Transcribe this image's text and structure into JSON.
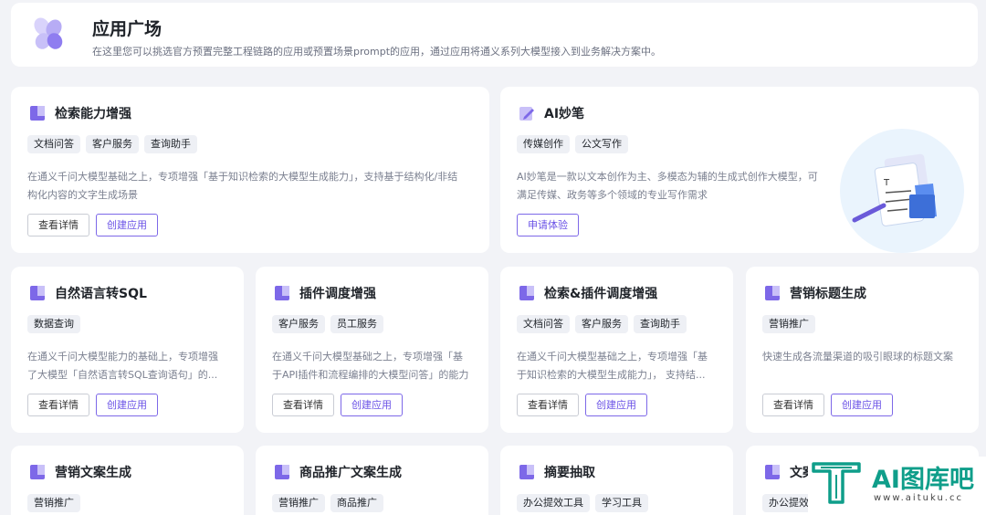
{
  "header": {
    "title": "应用广场",
    "desc": "在这里您可以挑选官方预置完整工程链路的应用或预置场景prompt的应用，通过应用将通义系列大模型接入到业务解决方案中。"
  },
  "cards": [
    {
      "title": "检索能力增强",
      "icon": "bookmark-icon",
      "tags": [
        "文档问答",
        "客户服务",
        "查询助手"
      ],
      "desc": [
        "在通义千问大模型基础之上，专项增强「基于知识检索的大模型生成能力」，支持基于结构化/非结",
        "构化内容的文字生成场景"
      ],
      "detail": "查看详情",
      "create": "创建应用"
    },
    {
      "title": "AI妙笔",
      "icon": "pen-icon",
      "tags": [
        "传媒创作",
        "公文写作"
      ],
      "desc": [
        "AI妙笔是一款以文本创作为主、多模态为辅的生成式创作大模型，可",
        "满足传媒、政务等多个领域的专业写作需求"
      ],
      "apply": "申请体验"
    },
    {
      "title": "自然语言转SQL",
      "icon": "bookmark-icon",
      "tags": [
        "数据查询"
      ],
      "desc": [
        "在通义千问大模型能力的基础上，专项增强",
        "了大模型「自然语言转SQL查询语句」的..."
      ],
      "detail": "查看详情",
      "create": "创建应用"
    },
    {
      "title": "插件调度增强",
      "icon": "bookmark-icon",
      "tags": [
        "客户服务",
        "员工服务"
      ],
      "desc": [
        "在通义千问大模型基础之上，专项增强「基",
        "于API插件和流程编排的大模型问答」的能力"
      ],
      "detail": "查看详情",
      "create": "创建应用"
    },
    {
      "title": "检索&插件调度增强",
      "icon": "bookmark-icon",
      "tags": [
        "文档问答",
        "客户服务",
        "查询助手"
      ],
      "desc": [
        "在通义千问大模型基础之上，专项增强「基",
        "于知识检索的大模型生成能力」，  支持结..."
      ],
      "detail": "查看详情",
      "create": "创建应用"
    },
    {
      "title": "营销标题生成",
      "icon": "bookmark-icon",
      "tags": [
        "营销推广"
      ],
      "desc": [
        "快速生成各流量渠道的吸引眼球的标题文案"
      ],
      "detail": "查看详情",
      "create": "创建应用"
    },
    {
      "title": "营销文案生成",
      "icon": "bookmark-icon",
      "tags": [
        "营销推广"
      ]
    },
    {
      "title": "商品推广文案生成",
      "icon": "bookmark-icon",
      "tags": [
        "营销推广",
        "商品推广"
      ]
    },
    {
      "title": "摘要抽取",
      "icon": "bookmark-icon",
      "tags": [
        "办公提效工具",
        "学习工具"
      ]
    },
    {
      "title": "文案",
      "icon": "bookmark-icon",
      "tags": [
        "办公提效"
      ]
    }
  ],
  "watermark": {
    "brand": "AI图库吧",
    "url": "www.aituku.cc",
    "logo_letter": "T"
  },
  "colors": {
    "accent": "#7d68e8",
    "accent_text": "#6a52e6",
    "watermark": "#0f9e8a"
  }
}
